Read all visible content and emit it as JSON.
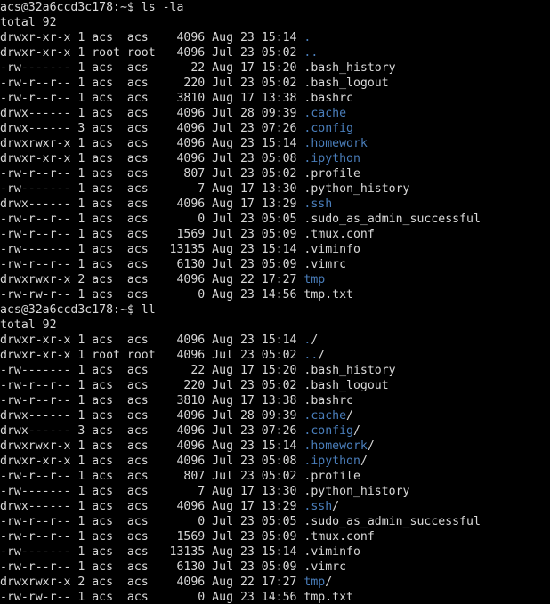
{
  "terminal": {
    "background_color": "#000000",
    "foreground_color": "#d8d8d8",
    "directory_color": "#4a7ebb",
    "prompt": "acs@32a6ccd3c178:~$",
    "user": "acs",
    "host": "32a6ccd3c178",
    "cwd": "~"
  },
  "sessions": [
    {
      "command": "ls -la",
      "total_line": "total 92",
      "entries": [
        {
          "perms": "drwxr-xr-x",
          "links": "1",
          "owner": "acs",
          "group": "acs",
          "size": "4096",
          "month": "Aug",
          "day": "23",
          "time": "15:14",
          "name": ".",
          "type": "dir"
        },
        {
          "perms": "drwxr-xr-x",
          "links": "1",
          "owner": "root",
          "group": "root",
          "size": "4096",
          "month": "Jul",
          "day": "23",
          "time": "05:02",
          "name": "..",
          "type": "dir"
        },
        {
          "perms": "-rw-------",
          "links": "1",
          "owner": "acs",
          "group": "acs",
          "size": "22",
          "month": "Aug",
          "day": "17",
          "time": "15:20",
          "name": ".bash_history",
          "type": "file"
        },
        {
          "perms": "-rw-r--r--",
          "links": "1",
          "owner": "acs",
          "group": "acs",
          "size": "220",
          "month": "Jul",
          "day": "23",
          "time": "05:02",
          "name": ".bash_logout",
          "type": "file"
        },
        {
          "perms": "-rw-r--r--",
          "links": "1",
          "owner": "acs",
          "group": "acs",
          "size": "3810",
          "month": "Aug",
          "day": "17",
          "time": "13:38",
          "name": ".bashrc",
          "type": "file"
        },
        {
          "perms": "drwx------",
          "links": "1",
          "owner": "acs",
          "group": "acs",
          "size": "4096",
          "month": "Jul",
          "day": "28",
          "time": "09:39",
          "name": ".cache",
          "type": "dir"
        },
        {
          "perms": "drwx------",
          "links": "3",
          "owner": "acs",
          "group": "acs",
          "size": "4096",
          "month": "Jul",
          "day": "23",
          "time": "07:26",
          "name": ".config",
          "type": "dir"
        },
        {
          "perms": "drwxrwxr-x",
          "links": "1",
          "owner": "acs",
          "group": "acs",
          "size": "4096",
          "month": "Aug",
          "day": "23",
          "time": "15:14",
          "name": ".homework",
          "type": "dir"
        },
        {
          "perms": "drwxr-xr-x",
          "links": "1",
          "owner": "acs",
          "group": "acs",
          "size": "4096",
          "month": "Jul",
          "day": "23",
          "time": "05:08",
          "name": ".ipython",
          "type": "dir"
        },
        {
          "perms": "-rw-r--r--",
          "links": "1",
          "owner": "acs",
          "group": "acs",
          "size": "807",
          "month": "Jul",
          "day": "23",
          "time": "05:02",
          "name": ".profile",
          "type": "file"
        },
        {
          "perms": "-rw-------",
          "links": "1",
          "owner": "acs",
          "group": "acs",
          "size": "7",
          "month": "Aug",
          "day": "17",
          "time": "13:30",
          "name": ".python_history",
          "type": "file"
        },
        {
          "perms": "drwx------",
          "links": "1",
          "owner": "acs",
          "group": "acs",
          "size": "4096",
          "month": "Aug",
          "day": "17",
          "time": "13:29",
          "name": ".ssh",
          "type": "dir"
        },
        {
          "perms": "-rw-r--r--",
          "links": "1",
          "owner": "acs",
          "group": "acs",
          "size": "0",
          "month": "Jul",
          "day": "23",
          "time": "05:05",
          "name": ".sudo_as_admin_successful",
          "type": "file"
        },
        {
          "perms": "-rw-r--r--",
          "links": "1",
          "owner": "acs",
          "group": "acs",
          "size": "1569",
          "month": "Jul",
          "day": "23",
          "time": "05:09",
          "name": ".tmux.conf",
          "type": "file"
        },
        {
          "perms": "-rw-------",
          "links": "1",
          "owner": "acs",
          "group": "acs",
          "size": "13135",
          "month": "Aug",
          "day": "23",
          "time": "15:14",
          "name": ".viminfo",
          "type": "file"
        },
        {
          "perms": "-rw-r--r--",
          "links": "1",
          "owner": "acs",
          "group": "acs",
          "size": "6130",
          "month": "Jul",
          "day": "23",
          "time": "05:09",
          "name": ".vimrc",
          "type": "file"
        },
        {
          "perms": "drwxrwxr-x",
          "links": "2",
          "owner": "acs",
          "group": "acs",
          "size": "4096",
          "month": "Aug",
          "day": "22",
          "time": "17:27",
          "name": "tmp",
          "type": "dir"
        },
        {
          "perms": "-rw-rw-r--",
          "links": "1",
          "owner": "acs",
          "group": "acs",
          "size": "0",
          "month": "Aug",
          "day": "23",
          "time": "14:56",
          "name": "tmp.txt",
          "type": "file"
        }
      ],
      "classify": false
    },
    {
      "command": "ll",
      "total_line": "total 92",
      "entries": [
        {
          "perms": "drwxr-xr-x",
          "links": "1",
          "owner": "acs",
          "group": "acs",
          "size": "4096",
          "month": "Aug",
          "day": "23",
          "time": "15:14",
          "name": ".",
          "type": "dir"
        },
        {
          "perms": "drwxr-xr-x",
          "links": "1",
          "owner": "root",
          "group": "root",
          "size": "4096",
          "month": "Jul",
          "day": "23",
          "time": "05:02",
          "name": "..",
          "type": "dir"
        },
        {
          "perms": "-rw-------",
          "links": "1",
          "owner": "acs",
          "group": "acs",
          "size": "22",
          "month": "Aug",
          "day": "17",
          "time": "15:20",
          "name": ".bash_history",
          "type": "file"
        },
        {
          "perms": "-rw-r--r--",
          "links": "1",
          "owner": "acs",
          "group": "acs",
          "size": "220",
          "month": "Jul",
          "day": "23",
          "time": "05:02",
          "name": ".bash_logout",
          "type": "file"
        },
        {
          "perms": "-rw-r--r--",
          "links": "1",
          "owner": "acs",
          "group": "acs",
          "size": "3810",
          "month": "Aug",
          "day": "17",
          "time": "13:38",
          "name": ".bashrc",
          "type": "file"
        },
        {
          "perms": "drwx------",
          "links": "1",
          "owner": "acs",
          "group": "acs",
          "size": "4096",
          "month": "Jul",
          "day": "28",
          "time": "09:39",
          "name": ".cache",
          "type": "dir"
        },
        {
          "perms": "drwx------",
          "links": "3",
          "owner": "acs",
          "group": "acs",
          "size": "4096",
          "month": "Jul",
          "day": "23",
          "time": "07:26",
          "name": ".config",
          "type": "dir"
        },
        {
          "perms": "drwxrwxr-x",
          "links": "1",
          "owner": "acs",
          "group": "acs",
          "size": "4096",
          "month": "Aug",
          "day": "23",
          "time": "15:14",
          "name": ".homework",
          "type": "dir"
        },
        {
          "perms": "drwxr-xr-x",
          "links": "1",
          "owner": "acs",
          "group": "acs",
          "size": "4096",
          "month": "Jul",
          "day": "23",
          "time": "05:08",
          "name": ".ipython",
          "type": "dir"
        },
        {
          "perms": "-rw-r--r--",
          "links": "1",
          "owner": "acs",
          "group": "acs",
          "size": "807",
          "month": "Jul",
          "day": "23",
          "time": "05:02",
          "name": ".profile",
          "type": "file"
        },
        {
          "perms": "-rw-------",
          "links": "1",
          "owner": "acs",
          "group": "acs",
          "size": "7",
          "month": "Aug",
          "day": "17",
          "time": "13:30",
          "name": ".python_history",
          "type": "file"
        },
        {
          "perms": "drwx------",
          "links": "1",
          "owner": "acs",
          "group": "acs",
          "size": "4096",
          "month": "Aug",
          "day": "17",
          "time": "13:29",
          "name": ".ssh",
          "type": "dir"
        },
        {
          "perms": "-rw-r--r--",
          "links": "1",
          "owner": "acs",
          "group": "acs",
          "size": "0",
          "month": "Jul",
          "day": "23",
          "time": "05:05",
          "name": ".sudo_as_admin_successful",
          "type": "file"
        },
        {
          "perms": "-rw-r--r--",
          "links": "1",
          "owner": "acs",
          "group": "acs",
          "size": "1569",
          "month": "Jul",
          "day": "23",
          "time": "05:09",
          "name": ".tmux.conf",
          "type": "file"
        },
        {
          "perms": "-rw-------",
          "links": "1",
          "owner": "acs",
          "group": "acs",
          "size": "13135",
          "month": "Aug",
          "day": "23",
          "time": "15:14",
          "name": ".viminfo",
          "type": "file"
        },
        {
          "perms": "-rw-r--r--",
          "links": "1",
          "owner": "acs",
          "group": "acs",
          "size": "6130",
          "month": "Jul",
          "day": "23",
          "time": "05:09",
          "name": ".vimrc",
          "type": "file"
        },
        {
          "perms": "drwxrwxr-x",
          "links": "2",
          "owner": "acs",
          "group": "acs",
          "size": "4096",
          "month": "Aug",
          "day": "22",
          "time": "17:27",
          "name": "tmp",
          "type": "dir"
        },
        {
          "perms": "-rw-rw-r--",
          "links": "1",
          "owner": "acs",
          "group": "acs",
          "size": "0",
          "month": "Aug",
          "day": "23",
          "time": "14:56",
          "name": "tmp.txt",
          "type": "file"
        }
      ],
      "classify": true
    }
  ]
}
